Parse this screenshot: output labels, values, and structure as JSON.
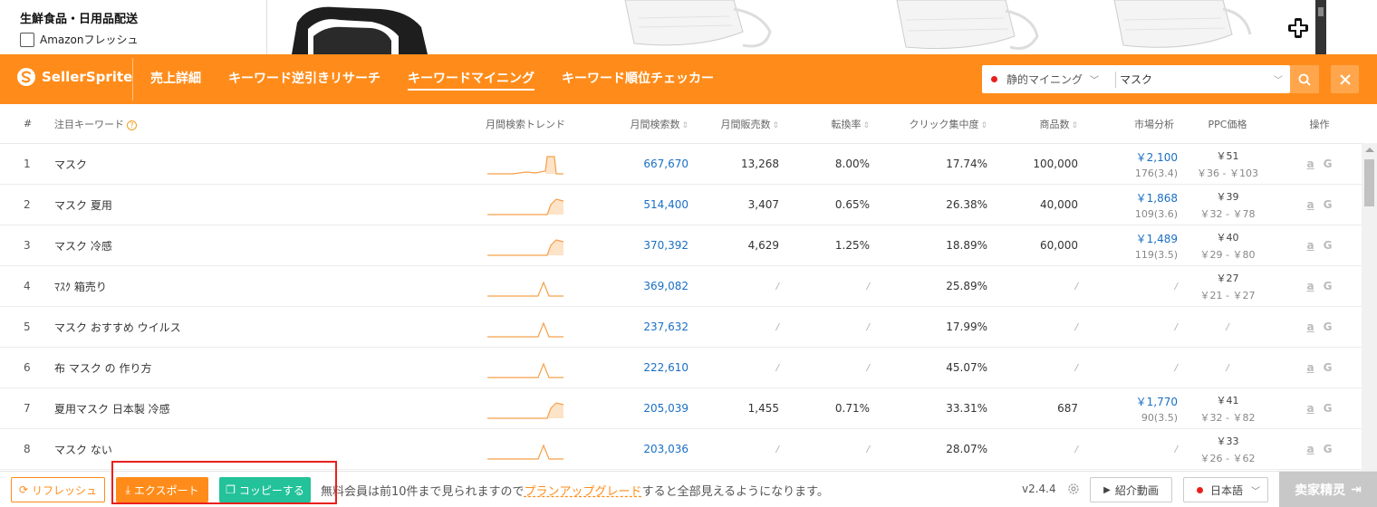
{
  "amazon": {
    "category": "生鮮食品・日用品配送",
    "fresh_label": "Amazonフレッシュ"
  },
  "brand": {
    "name": "SellerSprite",
    "accent": "#ff8c1a"
  },
  "nav": {
    "tabs": [
      {
        "label": "売上詳細",
        "active": false
      },
      {
        "label": "キーワード逆引きリサーチ",
        "active": false
      },
      {
        "label": "キーワードマイニング",
        "active": true
      },
      {
        "label": "キーワード順位チェッカー",
        "active": false
      }
    ]
  },
  "search": {
    "mode": "静的マイニング",
    "query": "マスク",
    "market_flag_color": "#e8201c"
  },
  "table": {
    "headers": {
      "idx": "#",
      "keyword": "注目キーワード",
      "trend": "月間検索トレンド",
      "search_volume": "月間検索数",
      "monthly_sales": "月間販売数",
      "conversion": "転換率",
      "click_concentration": "クリック集中度",
      "products": "商品数",
      "market": "市場分析",
      "ppc": "PPC価格",
      "ops": "操作"
    },
    "rows": [
      {
        "idx": "1",
        "keyword": "マスク",
        "trend": "spike-end",
        "search_volume": "667,670",
        "monthly_sales": "13,268",
        "conversion": "8.00%",
        "click_concentration": "17.74%",
        "products": "100,000",
        "market_main": "￥2,100",
        "market_sub": "176(3.4)",
        "ppc_main": "￥51",
        "ppc_sub": "￥36 - ￥103"
      },
      {
        "idx": "2",
        "keyword": "マスク 夏用",
        "trend": "rise-end",
        "search_volume": "514,400",
        "monthly_sales": "3,407",
        "conversion": "0.65%",
        "click_concentration": "26.38%",
        "products": "40,000",
        "market_main": "￥1,868",
        "market_sub": "109(3.6)",
        "ppc_main": "￥39",
        "ppc_sub": "￥32 - ￥78"
      },
      {
        "idx": "3",
        "keyword": "マスク 冷感",
        "trend": "rise-end",
        "search_volume": "370,392",
        "monthly_sales": "4,629",
        "conversion": "1.25%",
        "click_concentration": "18.89%",
        "products": "60,000",
        "market_main": "￥1,489",
        "market_sub": "119(3.5)",
        "ppc_main": "￥40",
        "ppc_sub": "￥29 - ￥80"
      },
      {
        "idx": "4",
        "keyword": "ﾏｽｸ 箱売り",
        "trend": "spike-mid",
        "search_volume": "369,082",
        "monthly_sales": "/",
        "conversion": "/",
        "click_concentration": "25.89%",
        "products": "/",
        "market_main": "/",
        "market_sub": "",
        "ppc_main": "￥27",
        "ppc_sub": "￥21 - ￥27"
      },
      {
        "idx": "5",
        "keyword": "マスク おすすめ ウイルス",
        "trend": "spike-mid",
        "search_volume": "237,632",
        "monthly_sales": "/",
        "conversion": "/",
        "click_concentration": "17.99%",
        "products": "/",
        "market_main": "/",
        "market_sub": "",
        "ppc_main": "/",
        "ppc_sub": ""
      },
      {
        "idx": "6",
        "keyword": "布 マスク の 作り方",
        "trend": "spike-mid",
        "search_volume": "222,610",
        "monthly_sales": "/",
        "conversion": "/",
        "click_concentration": "45.07%",
        "products": "/",
        "market_main": "/",
        "market_sub": "",
        "ppc_main": "/",
        "ppc_sub": ""
      },
      {
        "idx": "7",
        "keyword": "夏用マスク 日本製 冷感",
        "trend": "rise-end",
        "search_volume": "205,039",
        "monthly_sales": "1,455",
        "conversion": "0.71%",
        "click_concentration": "33.31%",
        "products": "687",
        "market_main": "￥1,770",
        "market_sub": "90(3.5)",
        "ppc_main": "￥41",
        "ppc_sub": "￥32 - ￥82"
      },
      {
        "idx": "8",
        "keyword": "マスク ない",
        "trend": "spike-mid",
        "search_volume": "203,036",
        "monthly_sales": "/",
        "conversion": "/",
        "click_concentration": "28.07%",
        "products": "/",
        "market_main": "/",
        "market_sub": "",
        "ppc_main": "￥33",
        "ppc_sub": "￥26 - ￥62"
      }
    ]
  },
  "footer": {
    "refresh_label": "リフレッシュ",
    "export_label": "エクスポート",
    "copy_label": "コッピーする",
    "notice_prefix": "無料会員は前10件まで見られますので",
    "notice_link": "プランアップグレード",
    "notice_suffix": "すると全部見えるようになります。",
    "version": "v2.4.4",
    "video_label": "紹介動画",
    "language": "日本語",
    "brand_button": "卖家精灵"
  }
}
